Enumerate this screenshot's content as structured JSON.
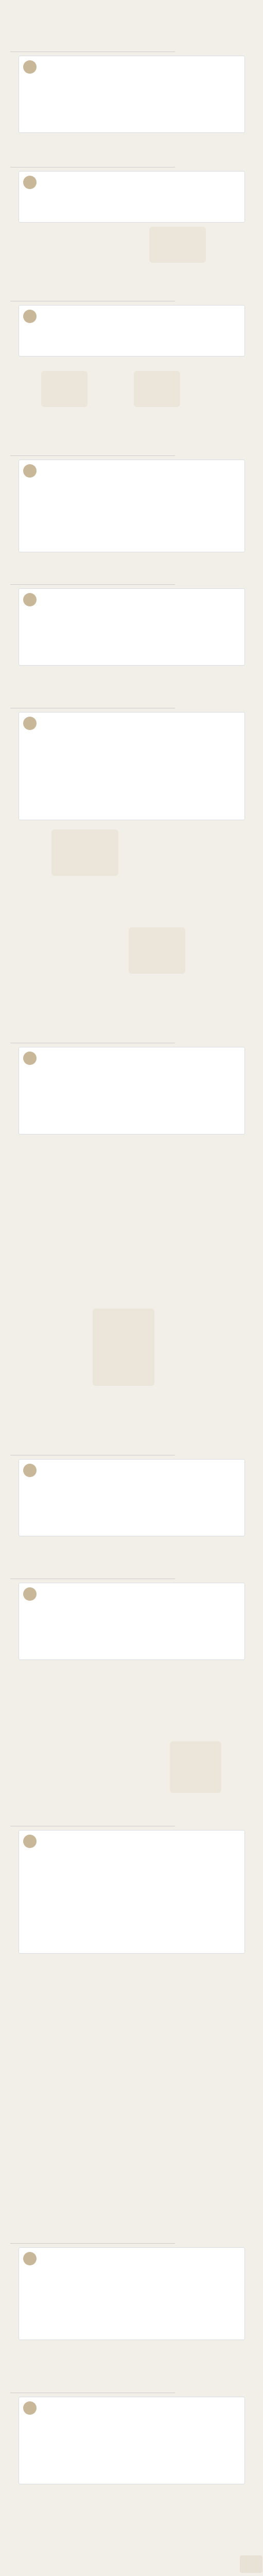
{
  "header": "",
  "sections": [
    {
      "number": "",
      "name": "",
      "card": {
        "author": "",
        "text": ""
      },
      "captions": []
    },
    {
      "number": "",
      "name": "",
      "card": {
        "author": "",
        "text": ""
      },
      "captions": []
    },
    {
      "number": "",
      "name": "",
      "card": {
        "author": "",
        "text": ""
      },
      "captions": []
    },
    {
      "number": "",
      "name": "",
      "card": {
        "author": "",
        "text": ""
      },
      "captions": []
    },
    {
      "number": "",
      "name": "",
      "card": {
        "author": "",
        "text": ""
      },
      "captions": []
    },
    {
      "number": "",
      "name": "",
      "card": {
        "author": "",
        "text": ""
      },
      "captions": []
    },
    {
      "number": "",
      "name": "",
      "card": {
        "author": "",
        "text": ""
      },
      "captions": []
    },
    {
      "number": "",
      "name": "",
      "card": {
        "author": "",
        "text": ""
      },
      "captions": []
    },
    {
      "number": "",
      "name": "",
      "card": {
        "author": "",
        "text": ""
      },
      "captions": []
    },
    {
      "number": "",
      "name": "",
      "card": {
        "author": "",
        "text": ""
      },
      "captions": []
    },
    {
      "number": "",
      "name": "",
      "card": {
        "author": "",
        "text": ""
      },
      "captions": []
    },
    {
      "number": "",
      "name": "",
      "card": {
        "author": "",
        "text": ""
      },
      "captions": []
    }
  ],
  "footer": ""
}
